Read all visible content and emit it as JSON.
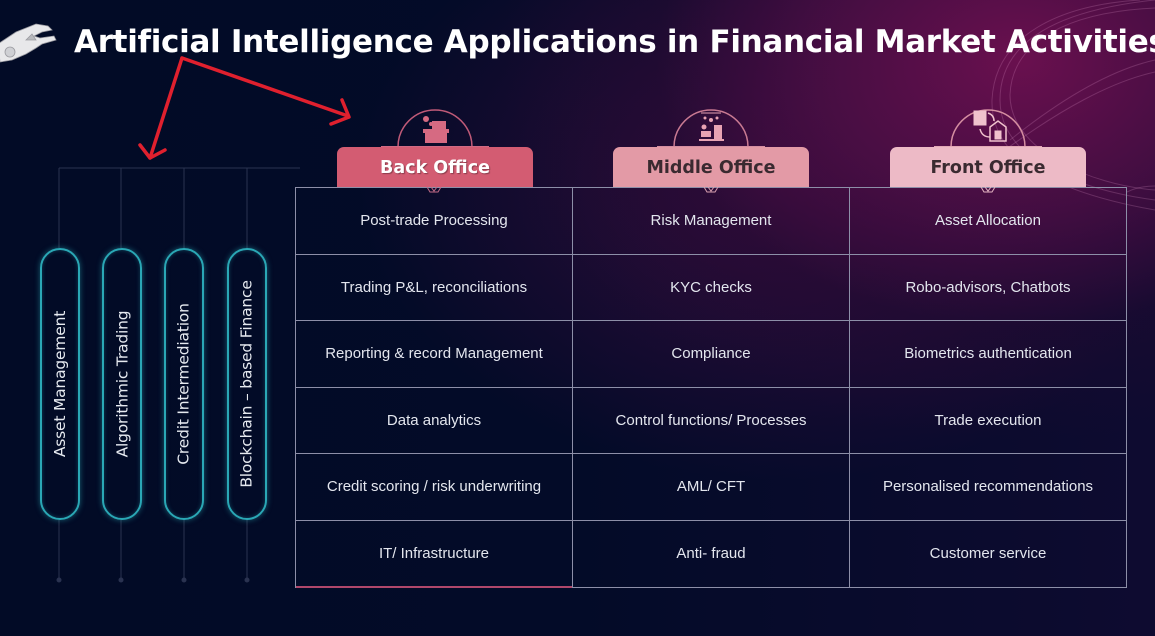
{
  "title": "Artificial Intelligence Applications in Financial Market Activities",
  "icons": {
    "title_icon": "robot-hand-icon",
    "back_office_icon": "office-desk-icon",
    "middle_office_icon": "workstation-icon",
    "front_office_icon": "building-to-home-icon"
  },
  "colors": {
    "background": "#020b26",
    "accent_red": "#e0202e",
    "pill_border": "#2aa7b5",
    "back_office": "#d35c72",
    "middle_office": "#e39aa6",
    "front_office": "#edbac6"
  },
  "applications": [
    {
      "label": "Asset Management"
    },
    {
      "label": "Algorithmic Trading"
    },
    {
      "label": "Credit Intermediation"
    },
    {
      "label": "Blockchain – based Finance"
    }
  ],
  "columns": [
    {
      "header": "Back Office",
      "items": [
        "Post-trade Processing",
        "Trading P&L, reconciliations",
        "Reporting & record Management",
        "Data analytics",
        "Credit scoring / risk underwriting",
        "IT/ Infrastructure"
      ]
    },
    {
      "header": "Middle Office",
      "items": [
        "Risk Management",
        "KYC checks",
        "Compliance",
        "Control functions/ Processes",
        "AML/ CFT",
        "Anti- fraud"
      ]
    },
    {
      "header": "Front Office",
      "items": [
        "Asset Allocation",
        "Robo-advisors, Chatbots",
        "Biometrics authentication",
        "Trade execution",
        "Personalised recommendations",
        "Customer service"
      ]
    }
  ]
}
